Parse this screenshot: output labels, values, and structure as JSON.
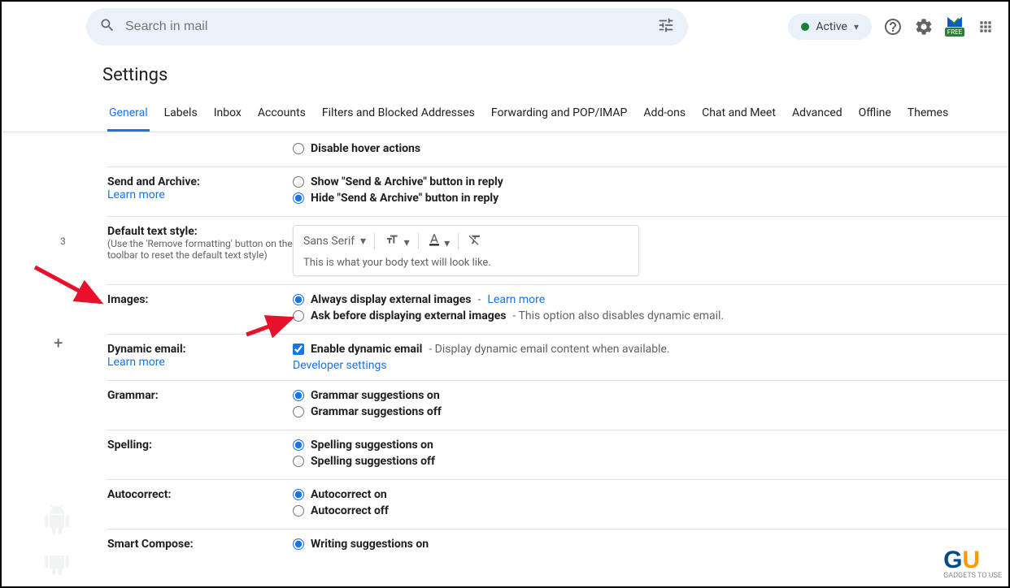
{
  "header": {
    "search_placeholder": "Search in mail",
    "status_label": "Active"
  },
  "page_title": "Settings",
  "tabs": [
    "General",
    "Labels",
    "Inbox",
    "Accounts",
    "Filters and Blocked Addresses",
    "Forwarding and POP/IMAP",
    "Add-ons",
    "Chat and Meet",
    "Advanced",
    "Offline",
    "Themes"
  ],
  "sidebar": {
    "badge": "3"
  },
  "rows": {
    "hover": {
      "options": [
        {
          "label": "Disable hover actions",
          "checked": false
        }
      ]
    },
    "send_archive": {
      "title": "Send and Archive:",
      "learn_more": "Learn more",
      "options": [
        {
          "label": "Show \"Send & Archive\" button in reply",
          "checked": false
        },
        {
          "label": "Hide \"Send & Archive\" button in reply",
          "checked": true
        }
      ]
    },
    "default_text_style": {
      "title": "Default text style:",
      "note": "(Use the 'Remove formatting' button on the toolbar to reset the default text style)",
      "font": "Sans Serif",
      "sample": "This is what your body text will look like."
    },
    "images": {
      "title": "Images:",
      "options": [
        {
          "label": "Always display external images",
          "extra": " - ",
          "link": "Learn more",
          "checked": true
        },
        {
          "label": "Ask before displaying external images",
          "extra": " - This option also disables dynamic email.",
          "checked": false
        }
      ]
    },
    "dynamic_email": {
      "title": "Dynamic email:",
      "learn_more": "Learn more",
      "checkbox_label": "Enable dynamic email",
      "checkbox_extra": " - Display dynamic email content when available.",
      "dev_link": "Developer settings"
    },
    "grammar": {
      "title": "Grammar:",
      "options": [
        {
          "label": "Grammar suggestions on",
          "checked": true
        },
        {
          "label": "Grammar suggestions off",
          "checked": false
        }
      ]
    },
    "spelling": {
      "title": "Spelling:",
      "options": [
        {
          "label": "Spelling suggestions on",
          "checked": true
        },
        {
          "label": "Spelling suggestions off",
          "checked": false
        }
      ]
    },
    "autocorrect": {
      "title": "Autocorrect:",
      "options": [
        {
          "label": "Autocorrect on",
          "checked": true
        },
        {
          "label": "Autocorrect off",
          "checked": false
        }
      ]
    },
    "smart_compose": {
      "title": "Smart Compose:",
      "options": [
        {
          "label": "Writing suggestions on",
          "checked": true
        }
      ]
    }
  },
  "watermark": "GADGETS TO USE"
}
